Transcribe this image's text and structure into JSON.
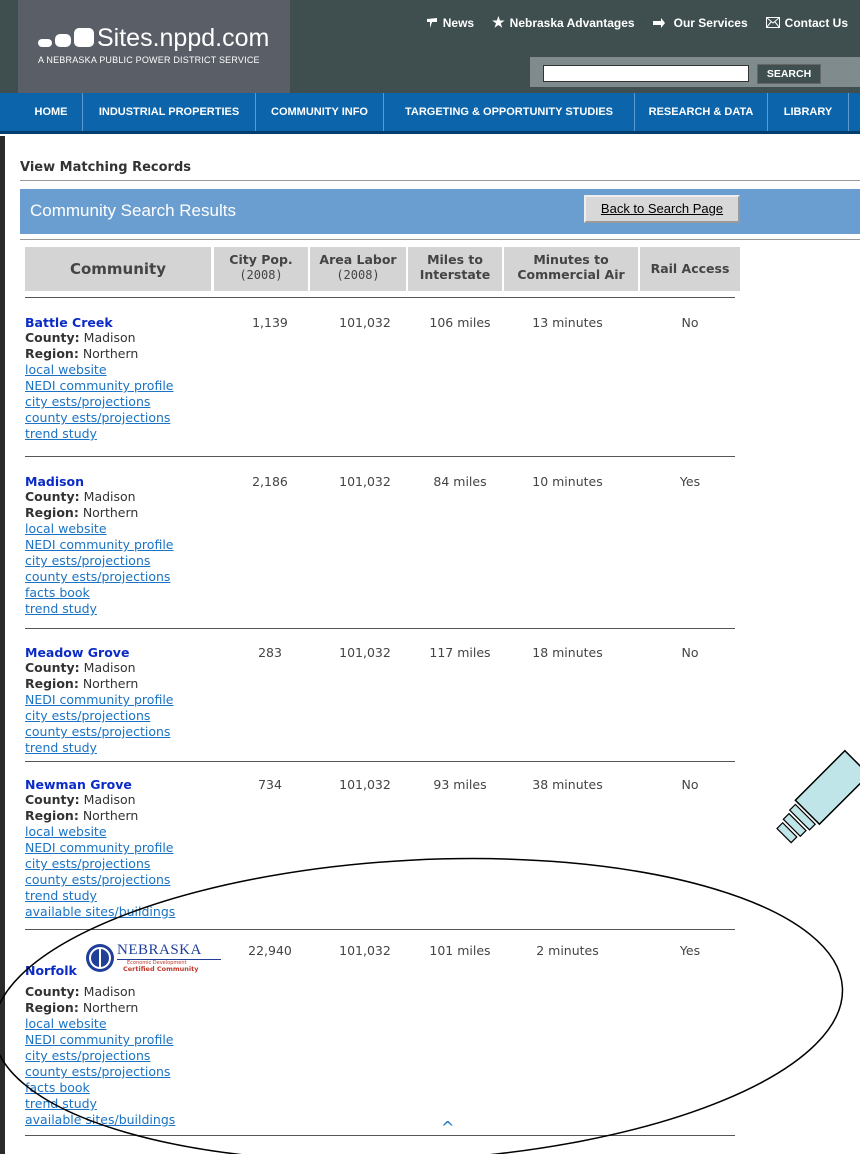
{
  "header": {
    "site_name": "Sites.nppd.com",
    "tagline": "A NEBRASKA PUBLIC POWER DISTRICT SERVICE",
    "top_links": [
      "News",
      "Nebraska Advantages",
      "Our Services",
      "Contact Us"
    ],
    "search_value": "",
    "search_button": "SEARCH"
  },
  "nav": [
    "HOME",
    "INDUSTRIAL PROPERTIES",
    "COMMUNITY INFO",
    "TARGETING & OPPORTUNITY STUDIES",
    "RESEARCH & DATA",
    "LIBRARY"
  ],
  "page": {
    "view_records": "View Matching Records",
    "results_title": "Community Search Results",
    "back_button": "Back to Search Page"
  },
  "table": {
    "headers": {
      "community": "Community",
      "city_pop": "City Pop.",
      "city_pop_sub": "(2008)",
      "area_labor": "Area Labor",
      "area_labor_sub": "(2008)",
      "miles": "Miles to",
      "miles_sub": "Interstate",
      "minutes": "Minutes to",
      "minutes_sub": "Commercial Air",
      "rail": "Rail Access"
    },
    "county_label": "County:",
    "region_label": "Region:",
    "rows": [
      {
        "name": "Battle Creek",
        "county": "Madison",
        "region": "Northern",
        "links": [
          "local website",
          "NEDI community profile",
          "city ests/projections",
          "county ests/projections",
          "trend study"
        ],
        "pop": "1,139",
        "labor": "101,032",
        "miles": "106 miles",
        "minutes": "13 minutes",
        "rail": "No"
      },
      {
        "name": "Madison",
        "county": "Madison",
        "region": "Northern",
        "links": [
          "local website",
          "NEDI community profile",
          "city ests/projections",
          "county ests/projections",
          "facts book",
          "trend study"
        ],
        "pop": "2,186",
        "labor": "101,032",
        "miles": "84 miles",
        "minutes": "10 minutes",
        "rail": "Yes"
      },
      {
        "name": "Meadow Grove",
        "county": "Madison",
        "region": "Northern",
        "links": [
          "NEDI community profile",
          "city ests/projections",
          "county ests/projections",
          "trend study"
        ],
        "pop": "283",
        "labor": "101,032",
        "miles": "117 miles",
        "minutes": "18 minutes",
        "rail": "No"
      },
      {
        "name": "Newman Grove",
        "county": "Madison",
        "region": "Northern",
        "links": [
          "local website",
          "NEDI community profile",
          "city ests/projections",
          "county ests/projections",
          "trend study",
          "available sites/buildings"
        ],
        "pop": "734",
        "labor": "101,032",
        "miles": "93 miles",
        "minutes": "38 minutes",
        "rail": "No"
      },
      {
        "name": "Norfolk",
        "county": "Madison",
        "region": "Northern",
        "links": [
          "local website",
          "NEDI community profile",
          "city ests/projections",
          "county ests/projections",
          "facts book",
          "trend study",
          "available sites/buildings"
        ],
        "pop": "22,940",
        "labor": "101,032",
        "miles": "101 miles",
        "minutes": "2 minutes",
        "rail": "Yes",
        "badge": {
          "title": "NEBRASKA",
          "line1": "Economic Development",
          "line2": "Certified Community"
        }
      }
    ]
  },
  "colors": {
    "nav": "#0c64ab",
    "results_bar": "#6a9ed1",
    "header": "#3f4f50",
    "link": "#1a73c4",
    "name": "#0b2bc6"
  }
}
